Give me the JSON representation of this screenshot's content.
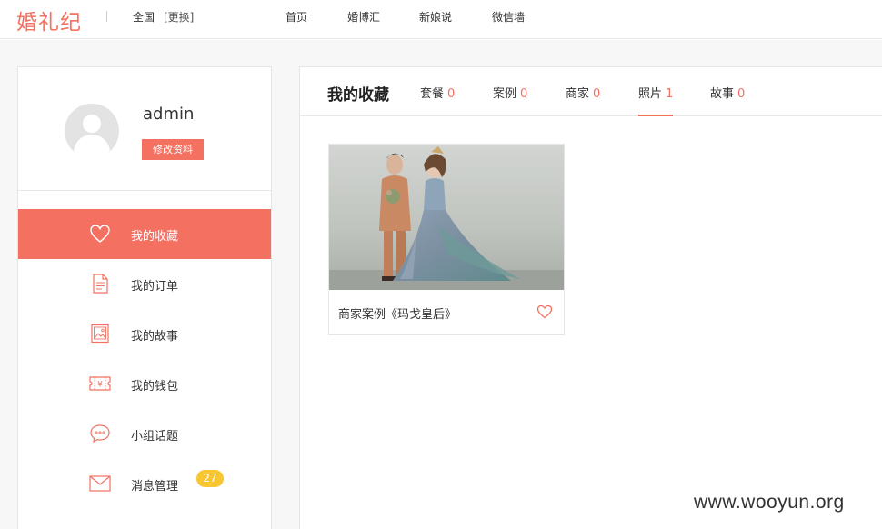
{
  "header": {
    "logo": "婚礼纪",
    "region": "全国",
    "region_switch": "[更换]",
    "nav": [
      "首页",
      "婚博汇",
      "新娘说",
      "微信墙"
    ]
  },
  "profile": {
    "username": "admin",
    "edit_label": "修改资料"
  },
  "sidebar": {
    "items": [
      {
        "label": "我的收藏",
        "icon": "heart-icon",
        "active": true
      },
      {
        "label": "我的订单",
        "icon": "document-icon"
      },
      {
        "label": "我的故事",
        "icon": "picture-icon"
      },
      {
        "label": "我的钱包",
        "icon": "wallet-ticket-icon"
      },
      {
        "label": "小组话题",
        "icon": "chat-bubble-icon"
      },
      {
        "label": "消息管理",
        "icon": "envelope-icon",
        "badge": "27"
      }
    ]
  },
  "main": {
    "title": "我的收藏",
    "tabs": [
      {
        "label": "套餐",
        "count": "0"
      },
      {
        "label": "案例",
        "count": "0"
      },
      {
        "label": "商家",
        "count": "0"
      },
      {
        "label": "照片",
        "count": "1",
        "active": true
      },
      {
        "label": "故事",
        "count": "0"
      }
    ],
    "cards": [
      {
        "title": "商家案例《玛戈皇后》",
        "image": "wedding-couple-photo"
      }
    ]
  },
  "watermark": "www.wooyun.org",
  "colors": {
    "accent": "#f47161",
    "badge": "#f7c631"
  }
}
